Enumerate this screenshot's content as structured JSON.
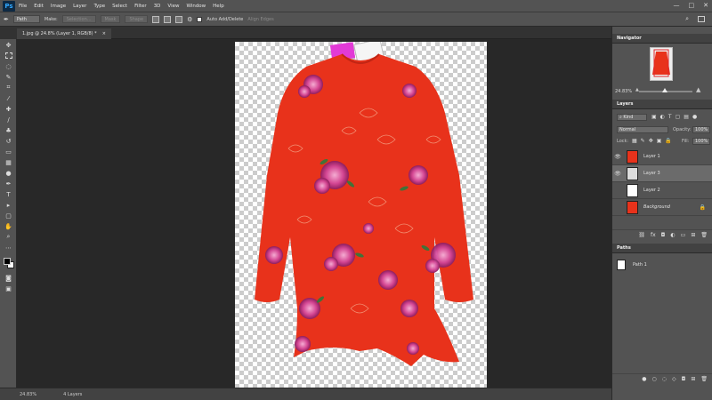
{
  "app": {
    "logo": "Ps"
  },
  "menu": [
    "File",
    "Edit",
    "Image",
    "Layer",
    "Type",
    "Select",
    "Filter",
    "3D",
    "View",
    "Window",
    "Help"
  ],
  "options": {
    "mode": "Path",
    "make_label": "Make:",
    "selection": "Selection...",
    "mask": "Mask",
    "shape": "Shape",
    "auto_add_delete": "Auto Add/Delete",
    "align_edges": "Align Edges"
  },
  "document": {
    "tab_title": "1.jpg @ 24.8% (Layer 1, RGB/8) *",
    "close": "×"
  },
  "status": {
    "zoom": "24.83%",
    "layers_count": "4 Layers"
  },
  "navigator": {
    "title": "Navigator",
    "zoom": "24.83%"
  },
  "layers_panel": {
    "title": "Layers",
    "filter": "Kind",
    "blend_mode": "Normal",
    "opacity_label": "Opacity:",
    "opacity": "100%",
    "lock_label": "Lock:",
    "fill_label": "Fill:",
    "fill": "100%",
    "layers": [
      {
        "name": "Layer 1",
        "visible": true,
        "selected": false
      },
      {
        "name": "Layer 3",
        "visible": true,
        "selected": true
      },
      {
        "name": "Layer 2",
        "visible": false,
        "selected": false
      },
      {
        "name": "Background",
        "visible": false,
        "selected": false
      }
    ]
  },
  "paths_panel": {
    "title": "Paths",
    "paths": [
      "Path 1"
    ]
  },
  "colors": {
    "accent": "#31a8ff",
    "garment": "#e8321b",
    "flower": "#d4489a"
  }
}
